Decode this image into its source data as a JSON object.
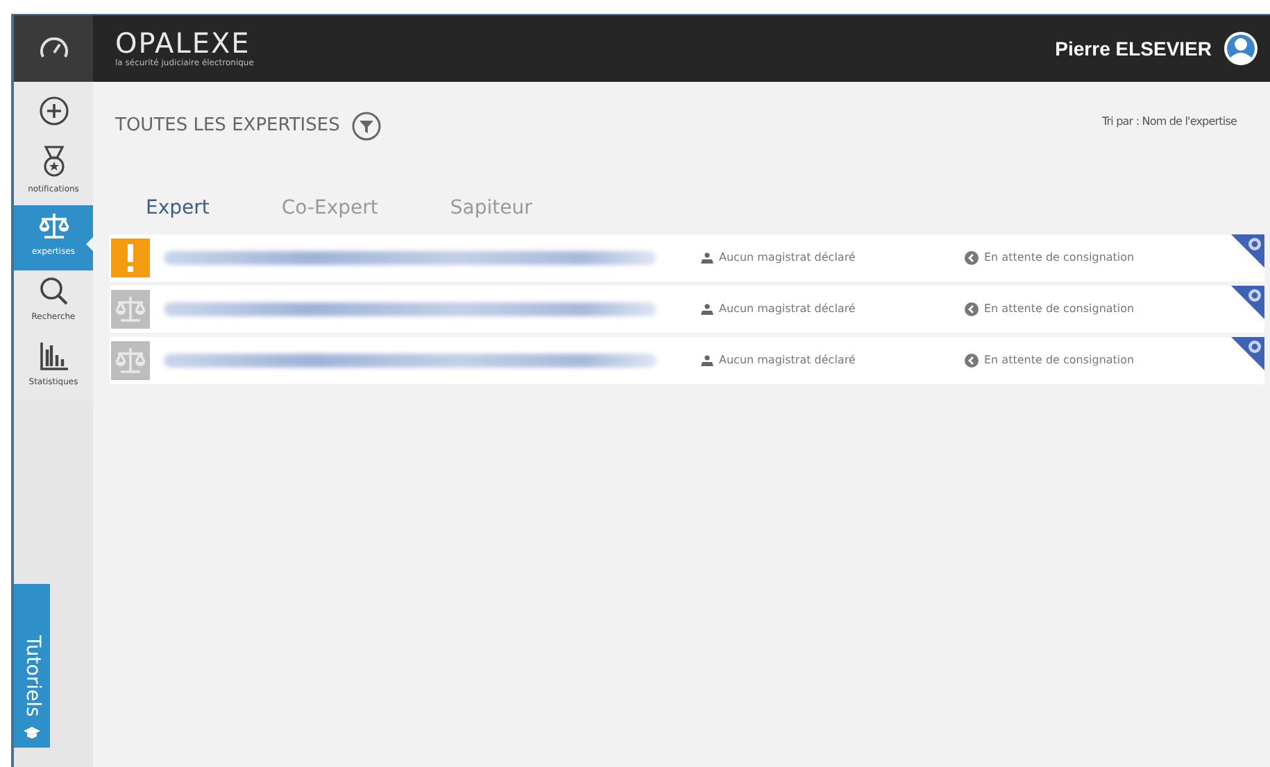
{
  "header": {
    "logo": "OPALEXE",
    "tagline": "la sécurité judiciaire électronique",
    "user": "Pierre ELSEVIER"
  },
  "sidebar": {
    "items": [
      {
        "kind": "add",
        "selected": false
      },
      {
        "kind": "medal",
        "label": "notifications",
        "selected": false
      },
      {
        "kind": "scale",
        "label": "expertises",
        "selected": true
      },
      {
        "kind": "search",
        "label": "Recherche",
        "selected": false
      },
      {
        "kind": "stats",
        "label": "Statistiques",
        "selected": false
      }
    ],
    "tutorial": "Tutoriels"
  },
  "main": {
    "title": "TOUTES LES EXPERTISES",
    "sort": "Tri par : Nom de l'expertise",
    "tabs": [
      {
        "label": "Expert",
        "selected": true
      },
      {
        "label": "Co-Expert",
        "selected": false
      },
      {
        "label": "Sapiteur",
        "selected": false
      }
    ],
    "rows": [
      {
        "kind": "alert",
        "magistrate": "Aucun magistrat déclaré",
        "status": "En attente de consignation"
      },
      {
        "kind": "scale",
        "magistrate": "Aucun magistrat déclaré",
        "status": "En attente de consignation"
      },
      {
        "kind": "scale",
        "magistrate": "Aucun magistrat déclaré",
        "status": "En attente de consignation"
      }
    ]
  }
}
